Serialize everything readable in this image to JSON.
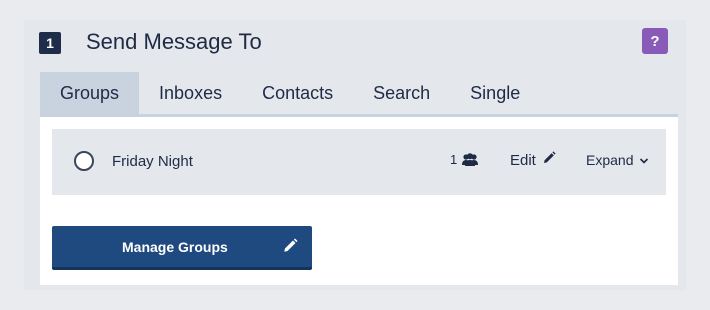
{
  "header": {
    "step_number": "1",
    "title": "Send Message To",
    "help_label": "?"
  },
  "tabs": [
    {
      "label": "Groups",
      "active": true
    },
    {
      "label": "Inboxes",
      "active": false
    },
    {
      "label": "Contacts",
      "active": false
    },
    {
      "label": "Search",
      "active": false
    },
    {
      "label": "Single",
      "active": false
    }
  ],
  "groups": [
    {
      "name": "Friday Night",
      "member_count": "1",
      "edit_label": "Edit",
      "expand_label": "Expand",
      "selected": false
    }
  ],
  "manage_button": {
    "label": "Manage Groups"
  },
  "icons": {
    "members": "users-icon",
    "edit": "pencil-icon",
    "expand": "chevron-down-icon",
    "manage": "pencil-icon"
  },
  "colors": {
    "accent": "#1f4a80",
    "help": "#8a5ab8",
    "active_tab": "#c9d3e0"
  }
}
